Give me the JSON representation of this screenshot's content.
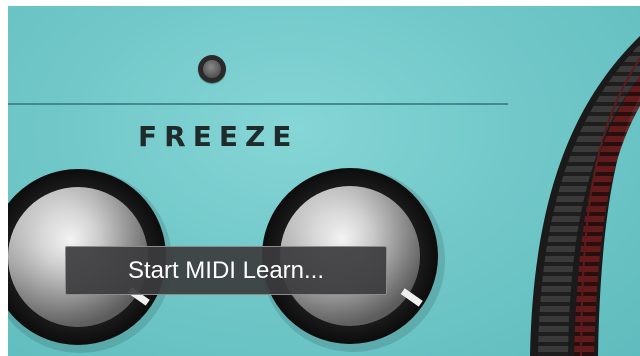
{
  "section": {
    "label": "FREEZE"
  },
  "context_menu": {
    "items": [
      {
        "label": "Start MIDI Learn..."
      }
    ]
  },
  "knobs": [
    {
      "name": "left-knob",
      "value": 0.8
    },
    {
      "name": "right-knob",
      "value": 0.8
    }
  ],
  "colors": {
    "panel_background": "#72c8c9",
    "divider": "#3b7f82",
    "label_text": "#1f2a2b",
    "menu_background": "#3c3c3e",
    "menu_text": "#ffffff",
    "meter_dark": "#2c2c2c",
    "meter_red": "#7a1d1d"
  },
  "icons": {
    "led": "indicator-light-icon"
  }
}
